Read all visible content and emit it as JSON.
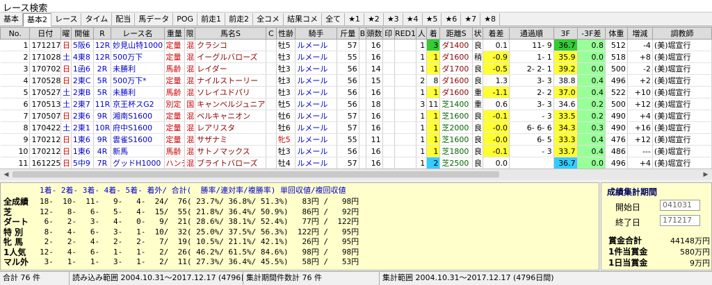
{
  "window": {
    "title": "レース検索"
  },
  "tabs": [
    "基本",
    "基本2",
    "レース",
    "タイム",
    "配当",
    "馬データ",
    "POG",
    "前走1",
    "前走2",
    "全コメ",
    "結果コメ",
    "全て",
    "★1",
    "★2",
    "★3",
    "★4",
    "★5",
    "★6",
    "★7",
    "★8"
  ],
  "active_tab": "基本2",
  "columns": [
    "No.",
    "日付",
    "曜",
    "開催",
    "R",
    "レース名",
    "重量",
    "限",
    "馬名S",
    "C",
    "性齢",
    "騎手",
    "斤量",
    "B",
    "頭数",
    "印",
    "RED1",
    "人",
    "着",
    "距離S",
    "状",
    "着差",
    "通過順",
    "3F",
    "-3F差",
    "体重",
    "増減",
    "調教師"
  ],
  "rows": [
    {
      "no": "1",
      "date": "171217",
      "dow": "日",
      "kaisai": "5阪6",
      "r": "12R",
      "race": "妙見山特1000",
      "jyuryo": "定量",
      "gen": "混",
      "horse": "クラシコ",
      "c": "",
      "sexage": "牡5",
      "jockey": "ルメール",
      "kinryo": "57",
      "b": "",
      "tosu": "16",
      "shirushi": "",
      "red1": "",
      "nin": "1",
      "chaku": "3",
      "kyori": "ダ1400",
      "jyo": "良",
      "chakusa": "0.1",
      "tsuka": "11- 9",
      "f3": "36.7",
      "f3diff": "0.8",
      "weight": "512",
      "zougen": "-4",
      "trainer": "(美)堀宣行"
    },
    {
      "no": "2",
      "date": "171028",
      "dow": "土",
      "kaisai": "4東8",
      "r": "12R",
      "race": "500万下",
      "jyuryo": "定量",
      "gen": "混",
      "horse": "イーグルバローズ",
      "c": "",
      "sexage": "牡3",
      "jockey": "ルメール",
      "kinryo": "55",
      "b": "",
      "tosu": "16",
      "shirushi": "",
      "red1": "",
      "nin": "1",
      "chaku": "1",
      "kyori": "ダ1600",
      "jyo": "稍",
      "chakusa": "-0.9",
      "tsuka": "1- 1",
      "f3": "35.9",
      "f3diff": "0.0",
      "weight": "518",
      "zougen": "+8",
      "trainer": "(美)堀宣行"
    },
    {
      "no": "3",
      "date": "170702",
      "dow": "日",
      "kaisai": "1函6",
      "r": "2R",
      "race": "未勝利",
      "jyuryo": "馬齢",
      "gen": "混",
      "horse": "レイダー",
      "c": "",
      "sexage": "牡3",
      "jockey": "ルメール",
      "kinryo": "56",
      "b": "",
      "tosu": "14",
      "shirushi": "",
      "red1": "",
      "nin": "1",
      "chaku": "1",
      "kyori": "ダ1700",
      "jyo": "良",
      "chakusa": "-0.5",
      "tsuka": "2- 2- 1",
      "f3": "39.2",
      "f3diff": "0.0",
      "weight": "500",
      "zougen": "-2",
      "trainer": "(美)堀宣行"
    },
    {
      "no": "4",
      "date": "170528",
      "dow": "日",
      "kaisai": "2東C",
      "r": "5R",
      "race": "500万下*",
      "jyuryo": "定量",
      "gen": "混",
      "horse": "ナイルストーリー",
      "c": "",
      "sexage": "牡3",
      "jockey": "ルメール",
      "kinryo": "56",
      "b": "",
      "tosu": "15",
      "shirushi": "",
      "red1": "",
      "nin": "2",
      "chaku": "8",
      "kyori": "ダ1600",
      "jyo": "良",
      "chakusa": "1.3",
      "tsuka": "3- 3",
      "f3": "38.8",
      "f3diff": "0.4",
      "weight": "496",
      "zougen": "+2",
      "trainer": "(美)堀宣行"
    },
    {
      "no": "5",
      "date": "170527",
      "dow": "土",
      "kaisai": "2東B",
      "r": "5R",
      "race": "未勝利",
      "jyuryo": "馬齢",
      "gen": "混",
      "horse": "ソレイユドパリ",
      "c": "",
      "sexage": "牡3",
      "jockey": "ルメール",
      "kinryo": "56",
      "b": "",
      "tosu": "16",
      "shirushi": "",
      "red1": "",
      "nin": "1",
      "chaku": "1",
      "kyori": "ダ1600",
      "jyo": "重",
      "chakusa": "-1.1",
      "tsuka": "2- 2",
      "f3": "37.0",
      "f3diff": "0.4",
      "weight": "522",
      "zougen": "+10",
      "trainer": "(美)堀宣行"
    },
    {
      "no": "6",
      "date": "170513",
      "dow": "土",
      "kaisai": "2東7",
      "r": "11R",
      "race": "京王杯スG2",
      "jyuryo": "別定",
      "gen": "国",
      "horse": "キャンベルジュニア",
      "c": "",
      "sexage": "牡5",
      "jockey": "ルメール",
      "kinryo": "56",
      "b": "",
      "tosu": "18",
      "shirushi": "",
      "red1": "",
      "nin": "3",
      "chaku": "11",
      "kyori": "芝1400",
      "jyo": "重",
      "chakusa": "0.6",
      "tsuka": "3- 3",
      "f3": "34.6",
      "f3diff": "0.2",
      "weight": "500",
      "zougen": "+12",
      "trainer": "(美)堀宣行"
    },
    {
      "no": "7",
      "date": "170507",
      "dow": "日",
      "kaisai": "2東6",
      "r": "9R",
      "race": "湘南S1600",
      "jyuryo": "定量",
      "gen": "混",
      "horse": "ベルキャニオン",
      "c": "",
      "sexage": "牡6",
      "jockey": "ルメール",
      "kinryo": "57",
      "b": "",
      "tosu": "16",
      "shirushi": "",
      "red1": "",
      "nin": "1",
      "chaku": "1",
      "kyori": "芝1600",
      "jyo": "良",
      "chakusa": "-0.1",
      "tsuka": "- 3",
      "f3": "33.5",
      "f3diff": "0.2",
      "weight": "490",
      "zougen": "+4",
      "trainer": "(美)堀宣行"
    },
    {
      "no": "8",
      "date": "170422",
      "dow": "土",
      "kaisai": "2東1",
      "r": "10R",
      "race": "府中S1600",
      "jyuryo": "定量",
      "gen": "混",
      "horse": "レアリスタ",
      "c": "",
      "sexage": "牡6",
      "jockey": "ルメール",
      "kinryo": "57",
      "b": "",
      "tosu": "16",
      "shirushi": "",
      "red1": "",
      "nin": "1",
      "chaku": "1",
      "kyori": "芝2000",
      "jyo": "良",
      "chakusa": "-0.0",
      "tsuka": "6- 6- 6",
      "f3": "34.3",
      "f3diff": "0.3",
      "weight": "490",
      "zougen": "+16",
      "trainer": "(美)堀宣行"
    },
    {
      "no": "9",
      "date": "170212",
      "dow": "日",
      "kaisai": "1東6",
      "r": "9R",
      "race": "雲雀S1600",
      "jyuryo": "定量",
      "gen": "混",
      "horse": "サザナミ",
      "c": "",
      "sexage": "牝5",
      "jockey": "ルメール",
      "kinryo": "55",
      "b": "",
      "tosu": "11",
      "shirushi": "",
      "red1": "",
      "nin": "1",
      "chaku": "1",
      "kyori": "芝1600",
      "jyo": "良",
      "chakusa": "-0.0",
      "tsuka": "6- 5",
      "f3": "33.3",
      "f3diff": "0.4",
      "weight": "476",
      "zougen": "+12",
      "trainer": "(美)堀宣行"
    },
    {
      "no": "10",
      "date": "170212",
      "dow": "日",
      "kaisai": "1東6",
      "r": "4R",
      "race": "新馬",
      "jyuryo": "馬齢",
      "gen": "混",
      "horse": "サトノマックス",
      "c": "",
      "sexage": "牡3",
      "jockey": "ルメール",
      "kinryo": "56",
      "b": "",
      "tosu": "16",
      "shirushi": "",
      "red1": "",
      "nin": "1",
      "chaku": "1",
      "kyori": "芝1800",
      "jyo": "良",
      "chakusa": "-0.1",
      "tsuka": "- 3",
      "f3": "33.7",
      "f3diff": "0.4",
      "weight": "486",
      "zougen": "---",
      "trainer": "(美)堀宣行"
    },
    {
      "no": "11",
      "date": "161225",
      "dow": "日",
      "kaisai": "5中9",
      "r": "7R",
      "race": "グッドH1000",
      "jyuryo": "ハンデ",
      "gen": "混",
      "horse": "ブライトバローズ",
      "c": "",
      "sexage": "牡4",
      "jockey": "ルメール",
      "kinryo": "57",
      "b": "",
      "tosu": "16",
      "shirushi": "",
      "red1": "",
      "nin": "1",
      "chaku": "2",
      "kyori": "芝2500",
      "jyo": "良",
      "chakusa": "0.0",
      "tsuka": "",
      "f3": "36.7",
      "f3diff": "0.0",
      "weight": "496",
      "zougen": "+4",
      "trainer": "(美)堀宣行"
    },
    {
      "no": "12",
      "date": "160821",
      "dow": "日",
      "kaisai": "2札4",
      "r": "11R",
      "race": "札幌記念G2",
      "jyuryo": "定量",
      "gen": "混",
      "horse": "ネオリアリズム",
      "c": "",
      "sexage": "牡5",
      "jockey": "ルメール",
      "kinryo": "57",
      "b": "",
      "tosu": "16",
      "shirushi": "",
      "red1": "",
      "nin": "2",
      "chaku": "1",
      "kyori": "芝2000",
      "jyo": "良",
      "chakusa": "0.0",
      "tsuka": "",
      "f3": "",
      "f3diff": "",
      "weight": "",
      "zougen": "",
      "trainer": "(美)堀宣行"
    }
  ],
  "stats": {
    "header": "1着- 2着- 3着- 4着- 5着- 着外/ 合計(  勝率/連対率/複勝率) 単回収値/複回収値",
    "rows": [
      {
        "label": "全成績",
        "values": "18-  10-  11-   9-   4-  24/  76( 23.7%/ 36.8%/ 51.3%)   83円 /   98円"
      },
      {
        "label": "芝",
        "values": "12-   8-   6-   5-   4-  15/  55( 21.8%/ 36.4%/ 50.9%)   86円 /   92円"
      },
      {
        "label": "ダート",
        "values": " 6-   2-   3-   4-   0-   9/  21( 28.6%/ 38.1%/ 52.4%)   77円 /  122円"
      },
      {
        "label": "特 別",
        "values": " 8-   4-   6-   3-   1-  10/  32( 25.0%/ 37.5%/ 56.3%)  122円 /   95円"
      },
      {
        "label": "牝 馬",
        "values": " 2-   2-   4-   2-   2-   7/  19( 10.5%/ 21.1%/ 42.1%)   26円 /   95円"
      },
      {
        "label": "1人気",
        "values": "12-   4-   6-   1-   1-   2/  26( 46.2%/ 61.5%/ 84.6%)   98円 /   98円"
      },
      {
        "label": "マル外",
        "values": " 3-   1-   1-   3-   1-   2/  11( 27.3%/ 36.4%/ 45.5%)   58円 /   53円"
      }
    ]
  },
  "summary": {
    "title": "成績集計期間",
    "start_label": "開始日",
    "start_value": "041031",
    "end_label": "終了日",
    "end_value": "171217",
    "prize_total_label": "賞金合計",
    "prize_total_value": "44148万円",
    "per_win_label": "1件当賞金",
    "per_win_value": "580万円",
    "per_day_label": "1日当賞金",
    "per_day_value": "9万円"
  },
  "statusbar": {
    "total": "合計 76 件",
    "read_range": "読み込み範囲 2004.10.31～2017.12.17 (4796日間)",
    "agg_count": "集計期間件数計 76 件",
    "agg_range": "集計範囲 2004.10.31～2017.12.17 (4796日間)"
  }
}
